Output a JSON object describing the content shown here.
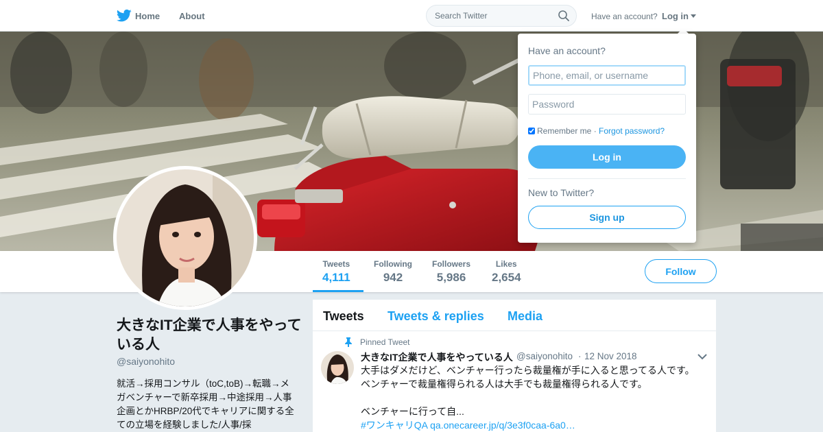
{
  "nav": {
    "home_label": "Home",
    "about_label": "About",
    "search_placeholder": "Search Twitter",
    "have_account": "Have an account?",
    "login_label": "Log in"
  },
  "profile_nav": {
    "stats": [
      {
        "label": "Tweets",
        "value": "4,111"
      },
      {
        "label": "Following",
        "value": "942"
      },
      {
        "label": "Followers",
        "value": "5,986"
      },
      {
        "label": "Likes",
        "value": "2,654"
      }
    ],
    "follow_label": "Follow"
  },
  "profile": {
    "name": "大きなIT企業で人事をやっている人",
    "handle": "@saiyonohito",
    "bio": "就活→採用コンサル（toC,toB)→転職→メガベンチャーで新卒採用→中途採用→人事企画とかHRBP/20代でキャリアに関する全ての立場を経験しました/人事/採"
  },
  "timeline": {
    "tabs": [
      "Tweets",
      "Tweets & replies",
      "Media"
    ],
    "pinned_label": "Pinned Tweet",
    "tweet": {
      "name": "大きなIT企業で人事をやっている人",
      "handle": "@saiyonohito",
      "separator": "·",
      "date": "12 Nov 2018",
      "line1": "大手はダメだけど、ベンチャー行ったら裁量権が手に入ると思ってる人です。",
      "line2": "ベンチャーで裁量権得られる人は大手でも裁量権得られる人です。",
      "line3": "ベンチャーに行って自...",
      "link": "#ワンキャリQA qa.onecareer.jp/q/3e3f0caa-6a0…"
    }
  },
  "login_dropdown": {
    "title": "Have an account?",
    "username_placeholder": "Phone, email, or username",
    "password_placeholder": "Password",
    "remember_label": "Remember me",
    "separator": "·",
    "forgot_label": "Forgot password?",
    "login_button": "Log in",
    "new_label": "New to Twitter?",
    "signup_button": "Sign up"
  },
  "colors": {
    "accent": "#1da1f2",
    "login_button": "#4ab3f4",
    "background": "#e6ecf0"
  }
}
